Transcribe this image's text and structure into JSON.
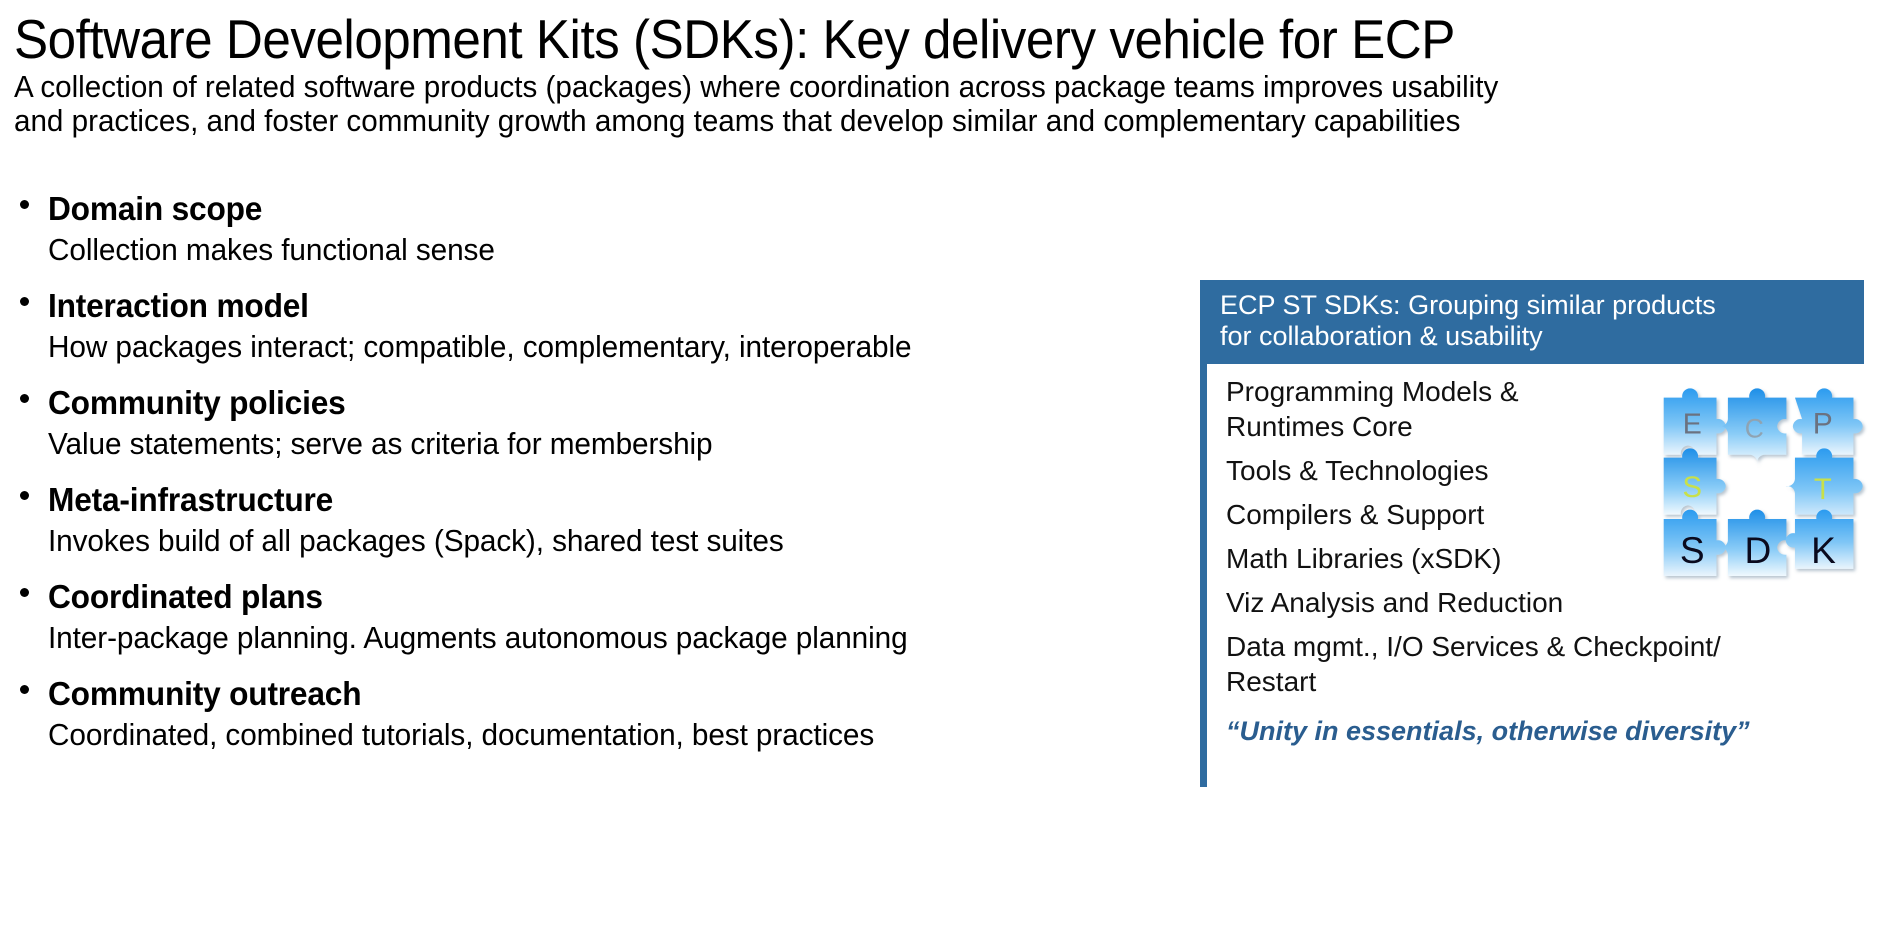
{
  "slide": {
    "title": "Software Development Kits (SDKs): Key delivery vehicle for ECP",
    "subtitle_line1": "A collection of related software products (packages) where coordination across package teams improves usability",
    "subtitle_line2": "and practices, and foster community growth among teams that develop similar and complementary capabilities"
  },
  "bullets": [
    {
      "title": "Domain scope",
      "desc": "Collection makes functional sense"
    },
    {
      "title": "Interaction model",
      "desc": "How packages interact; compatible, complementary, interoperable"
    },
    {
      "title": "Community policies",
      "desc": "Value statements; serve as criteria for membership"
    },
    {
      "title": "Meta-infrastructure",
      "desc": "Invokes build of all packages (Spack), shared test suites"
    },
    {
      "title": "Coordinated plans",
      "desc": "Inter-package planning. Augments autonomous package planning"
    },
    {
      "title": "Community outreach",
      "desc": "Coordinated, combined tutorials, documentation, best practices"
    }
  ],
  "sdk_panel": {
    "header_line1": "ECP ST SDKs: Grouping similar products",
    "header_line2": "for collaboration & usability",
    "items": [
      {
        "line1": "Programming Models &",
        "line2": "Runtimes Core"
      },
      {
        "line1": "Tools & Technologies",
        "line2": ""
      },
      {
        "line1": "Compilers & Support",
        "line2": ""
      },
      {
        "line1": "Math Libraries (xSDK)",
        "line2": ""
      },
      {
        "line1": "Viz Analysis and Reduction",
        "line2": ""
      },
      {
        "line1": "Data mgmt., I/O Services & Checkpoint/",
        "line2": "Restart"
      }
    ],
    "quote": "“Unity in essentials, otherwise diversity”",
    "colors": {
      "header_bg": "#2F6CA0",
      "rail": "#2F6CA0",
      "quote_text": "#2A5D8F"
    }
  },
  "puzzle_logo": {
    "rows": [
      {
        "letters": [
          "E",
          "C",
          "P"
        ],
        "color": "#6B7280"
      },
      {
        "letters": [
          "S",
          "",
          "T"
        ],
        "color": "#C8E04A"
      },
      {
        "letters": [
          "S",
          "D",
          "K"
        ],
        "color": "#0A0A1E"
      }
    ],
    "piece_color_top": "#2B9BEF",
    "piece_color_bottom": "#E8F4FD"
  }
}
